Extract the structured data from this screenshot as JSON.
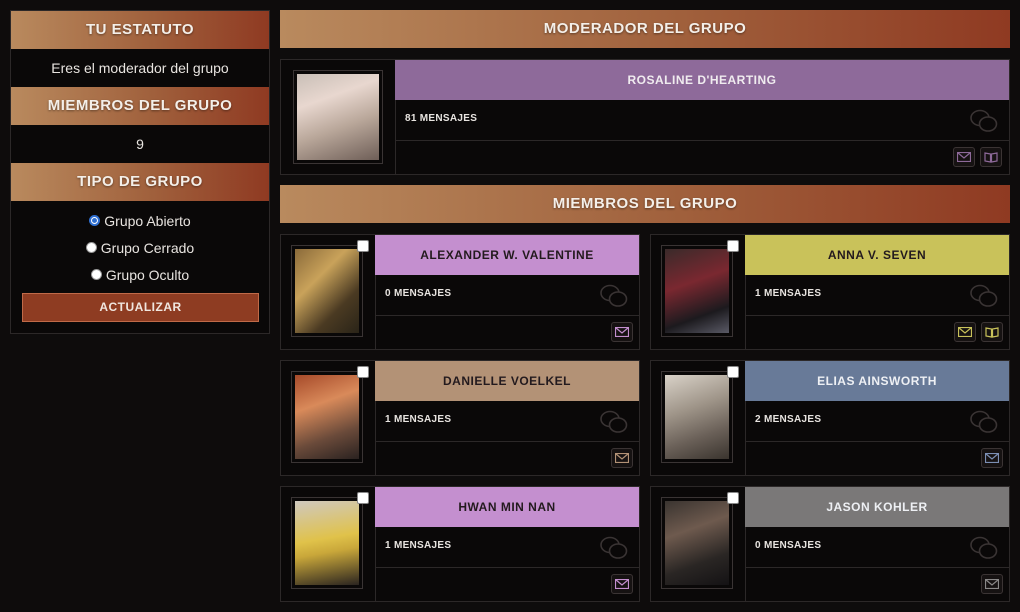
{
  "sidebar": {
    "status_title": "TU ESTATUTO",
    "status_text": "Eres el moderador del grupo",
    "members_title": "MIEMBROS DEL GRUPO",
    "members_count": "9",
    "type_title": "TIPO DE GRUPO",
    "options": [
      "Grupo Abierto",
      "Grupo Cerrado",
      "Grupo Oculto"
    ],
    "selected_option": "Grupo Abierto",
    "update_button": "ACTUALIZAR"
  },
  "moderator_section": {
    "title": "MODERADOR DEL GRUPO",
    "name": "ROSALINE D'HEARTING",
    "messages": "81 MENSAJES",
    "color": "#8e6a9a"
  },
  "members_section": {
    "title": "MIEMBROS DEL GRUPO",
    "members": [
      {
        "name": "ALEXANDER W. VALENTINE",
        "messages": "0 MENSAJES",
        "color": "#c48fcf",
        "icon_color": "#c48fcf",
        "book": false
      },
      {
        "name": "ANNA V. SEVEN",
        "messages": "1 MENSAJES",
        "color": "#c9c25a",
        "icon_color": "#c9c25a",
        "book": true
      },
      {
        "name": "DANIELLE VOELKEL",
        "messages": "1 MENSAJES",
        "color": "#b39276",
        "icon_color": "#b39276",
        "book": false
      },
      {
        "name": "ELIAS AINSWORTH",
        "messages": "2 MENSAJES",
        "color": "#687a98",
        "icon_color": "#7c8fb4",
        "book": false
      },
      {
        "name": "HWAN MIN NAN",
        "messages": "1 MENSAJES",
        "color": "#c48fcf",
        "icon_color": "#c48fcf",
        "book": false
      },
      {
        "name": "JASON KOHLER",
        "messages": "0 MENSAJES",
        "color": "#7a7878",
        "icon_color": "#8a8888",
        "book": false
      }
    ]
  },
  "icons": {
    "chat": "chat-bubbles-icon",
    "mail": "envelope-icon",
    "book": "book-icon"
  }
}
